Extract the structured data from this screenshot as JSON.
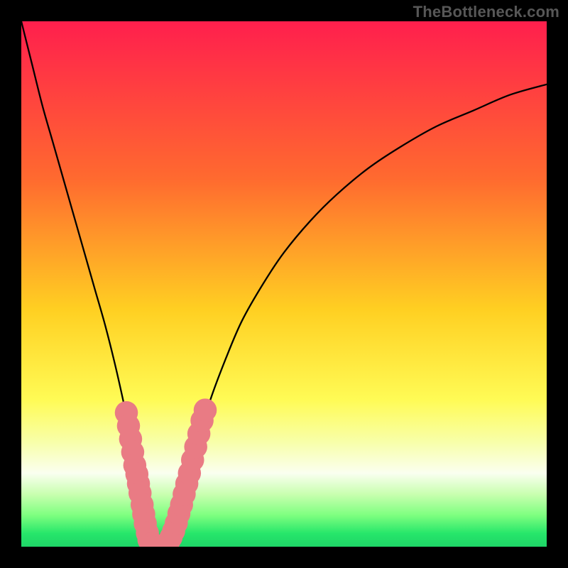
{
  "watermark": "TheBottleneck.com",
  "chart_data": {
    "type": "line",
    "title": "",
    "xlabel": "",
    "ylabel": "",
    "xlim": [
      0,
      100
    ],
    "ylim": [
      0,
      100
    ],
    "grid": false,
    "legend": false,
    "gradient_stops": [
      {
        "offset": 0.0,
        "color": "#ff1f4d"
      },
      {
        "offset": 0.3,
        "color": "#ff6a2f"
      },
      {
        "offset": 0.55,
        "color": "#ffd022"
      },
      {
        "offset": 0.72,
        "color": "#fffb55"
      },
      {
        "offset": 0.8,
        "color": "#f8ffa8"
      },
      {
        "offset": 0.86,
        "color": "#fafff0"
      },
      {
        "offset": 0.9,
        "color": "#c9ffb0"
      },
      {
        "offset": 0.94,
        "color": "#7eff80"
      },
      {
        "offset": 0.975,
        "color": "#26e66a"
      },
      {
        "offset": 1.0,
        "color": "#1fd567"
      }
    ],
    "series": [
      {
        "name": "left-branch",
        "color": "#000000",
        "x": [
          0,
          2,
          4,
          6,
          8,
          10,
          12,
          14,
          16,
          18,
          20,
          21,
          22,
          23,
          24,
          24.5
        ],
        "values": [
          100,
          92,
          84,
          77,
          70,
          63,
          56,
          49,
          42,
          34,
          25,
          20,
          14,
          8,
          2,
          0
        ]
      },
      {
        "name": "right-branch",
        "color": "#000000",
        "x": [
          28,
          29,
          30.5,
          32,
          34,
          36,
          39,
          42,
          46,
          50,
          55,
          60,
          66,
          72,
          79,
          86,
          93,
          100
        ],
        "values": [
          0,
          3,
          8,
          14,
          21,
          28,
          36,
          43,
          50,
          56,
          62,
          67,
          72,
          76,
          80,
          83,
          86,
          88
        ]
      }
    ],
    "scatter": {
      "name": "valley-points",
      "color": "#e97b84",
      "radius": 2.2,
      "points": [
        {
          "x": 20.0,
          "y": 25.5
        },
        {
          "x": 20.4,
          "y": 23.0
        },
        {
          "x": 20.8,
          "y": 20.5
        },
        {
          "x": 21.2,
          "y": 18.0
        },
        {
          "x": 21.6,
          "y": 15.5
        },
        {
          "x": 22.0,
          "y": 13.8
        },
        {
          "x": 22.3,
          "y": 12.0
        },
        {
          "x": 22.6,
          "y": 10.2
        },
        {
          "x": 23.0,
          "y": 8.0
        },
        {
          "x": 23.3,
          "y": 6.2
        },
        {
          "x": 23.6,
          "y": 4.4
        },
        {
          "x": 24.0,
          "y": 2.6
        },
        {
          "x": 24.3,
          "y": 1.3
        },
        {
          "x": 24.7,
          "y": 0.5
        },
        {
          "x": 25.2,
          "y": 0.1
        },
        {
          "x": 25.8,
          "y": 0.0
        },
        {
          "x": 26.4,
          "y": 0.0
        },
        {
          "x": 27.0,
          "y": 0.1
        },
        {
          "x": 27.5,
          "y": 0.4
        },
        {
          "x": 28.0,
          "y": 0.9
        },
        {
          "x": 28.5,
          "y": 1.8
        },
        {
          "x": 29.0,
          "y": 3.0
        },
        {
          "x": 29.5,
          "y": 4.5
        },
        {
          "x": 30.0,
          "y": 6.3
        },
        {
          "x": 30.5,
          "y": 8.0
        },
        {
          "x": 31.0,
          "y": 10.0
        },
        {
          "x": 31.5,
          "y": 12.0
        },
        {
          "x": 32.0,
          "y": 14.0
        },
        {
          "x": 32.6,
          "y": 16.5
        },
        {
          "x": 33.2,
          "y": 19.0
        },
        {
          "x": 33.8,
          "y": 21.5
        },
        {
          "x": 34.4,
          "y": 24.0
        },
        {
          "x": 35.0,
          "y": 26.0
        }
      ]
    }
  }
}
